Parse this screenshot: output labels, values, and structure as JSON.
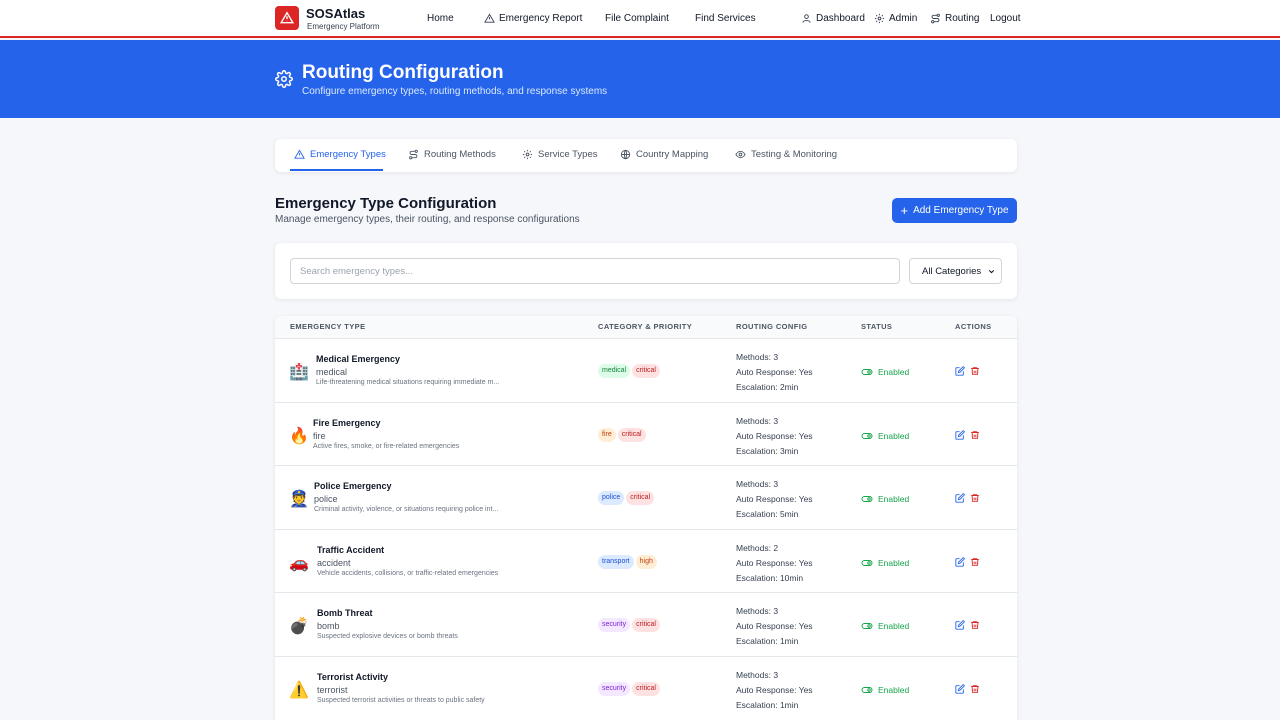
{
  "brand": {
    "name": "SOSAtlas",
    "subtitle": "Emergency Platform"
  },
  "nav": {
    "home": "Home",
    "emergency_report": "Emergency Report",
    "file_complaint": "File Complaint",
    "find_services": "Find Services",
    "dashboard": "Dashboard",
    "admin": "Admin",
    "routing": "Routing",
    "logout": "Logout"
  },
  "hero": {
    "title": "Routing Configuration",
    "subtitle": "Configure emergency types, routing methods, and response systems"
  },
  "tabs": [
    {
      "label": "Emergency Types",
      "icon": "alert-triangle-icon",
      "active": true
    },
    {
      "label": "Routing Methods",
      "icon": "route-icon",
      "active": false
    },
    {
      "label": "Service Types",
      "icon": "gear-icon",
      "active": false
    },
    {
      "label": "Country Mapping",
      "icon": "globe-icon",
      "active": false
    },
    {
      "label": "Testing & Monitoring",
      "icon": "eye-icon",
      "active": false
    }
  ],
  "section": {
    "title": "Emergency Type Configuration",
    "subtitle": "Manage emergency types, their routing, and response configurations",
    "add_button": "Add Emergency Type"
  },
  "search": {
    "placeholder": "Search emergency types...",
    "value": ""
  },
  "filter": {
    "selected": "All Categories"
  },
  "table": {
    "headers": [
      "EMERGENCY TYPE",
      "CATEGORY & PRIORITY",
      "ROUTING CONFIG",
      "STATUS",
      "ACTIONS"
    ],
    "rows": [
      {
        "emoji": "🏥",
        "name": "Medical Emergency",
        "code": "medical",
        "description": "Life-threatening medical situations requiring immediate m...",
        "category": "medical",
        "priority": "critical",
        "methods": "Methods: 3",
        "auto_response": "Auto Response: Yes",
        "escalation": "Escalation: 2min",
        "status": "Enabled"
      },
      {
        "emoji": "🔥",
        "name": "Fire Emergency",
        "code": "fire",
        "description": "Active fires, smoke, or fire-related emergencies",
        "category": "fire",
        "priority": "critical",
        "methods": "Methods: 3",
        "auto_response": "Auto Response: Yes",
        "escalation": "Escalation: 3min",
        "status": "Enabled"
      },
      {
        "emoji": "👮",
        "name": "Police Emergency",
        "code": "police",
        "description": "Criminal activity, violence, or situations requiring police int...",
        "category": "police",
        "priority": "critical",
        "methods": "Methods: 3",
        "auto_response": "Auto Response: Yes",
        "escalation": "Escalation: 5min",
        "status": "Enabled"
      },
      {
        "emoji": "🚗",
        "name": "Traffic Accident",
        "code": "accident",
        "description": "Vehicle accidents, collisions, or traffic-related emergencies",
        "category": "transport",
        "priority": "high",
        "methods": "Methods: 2",
        "auto_response": "Auto Response: Yes",
        "escalation": "Escalation: 10min",
        "status": "Enabled"
      },
      {
        "emoji": "💣",
        "name": "Bomb Threat",
        "code": "bomb",
        "description": "Suspected explosive devices or bomb threats",
        "category": "security",
        "priority": "critical",
        "methods": "Methods: 3",
        "auto_response": "Auto Response: Yes",
        "escalation": "Escalation: 1min",
        "status": "Enabled"
      },
      {
        "emoji": "⚠️",
        "name": "Terrorist Activity",
        "code": "terrorist",
        "description": "Suspected terrorist activities or threats to public safety",
        "category": "security",
        "priority": "critical",
        "methods": "Methods: 3",
        "auto_response": "Auto Response: Yes",
        "escalation": "Escalation: 1min",
        "status": "Enabled"
      }
    ]
  },
  "colors": {
    "primary": "#2563eb",
    "danger": "#dc2626",
    "success": "#16a34a",
    "badge_medical": "#dcfce7",
    "badge_fire": "#ffedd5",
    "badge_police": "#dbeafe",
    "badge_transport": "#dbeafe",
    "badge_security": "#f3e8ff",
    "badge_critical": "#fee2e2",
    "badge_high": "#ffedd5"
  }
}
